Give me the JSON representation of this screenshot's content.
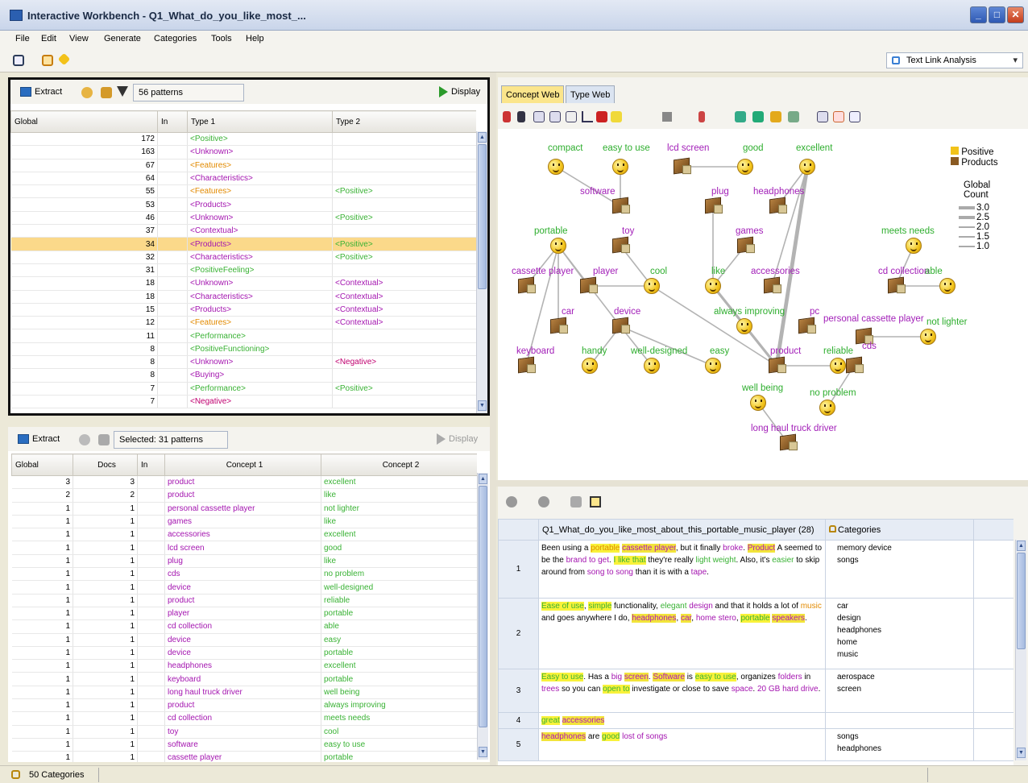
{
  "window": {
    "title": "Interactive Workbench - Q1_What_do_you_like_most_...",
    "buttons": [
      "_",
      "□",
      "✕"
    ]
  },
  "menu": [
    "File",
    "Edit",
    "View",
    "Generate",
    "Categories",
    "Tools",
    "Help"
  ],
  "mode_dropdown": {
    "value": "Text Link Analysis"
  },
  "top_left": {
    "extract_label": "Extract",
    "count_label": "56 patterns",
    "display_label": "Display",
    "columns": [
      "Global",
      "In",
      "Type 1",
      "Type 2"
    ],
    "rows": [
      {
        "global": "172",
        "t1": "<Positive>",
        "t1c": "g",
        "t2": "",
        "t2c": ""
      },
      {
        "global": "163",
        "t1": "<Unknown>",
        "t1c": "p",
        "t2": "",
        "t2c": ""
      },
      {
        "global": "67",
        "t1": "<Features>",
        "t1c": "o",
        "t2": "",
        "t2c": ""
      },
      {
        "global": "64",
        "t1": "<Characteristics>",
        "t1c": "p",
        "t2": "",
        "t2c": ""
      },
      {
        "global": "55",
        "t1": "<Features>",
        "t1c": "o",
        "t2": "<Positive>",
        "t2c": "g"
      },
      {
        "global": "53",
        "t1": "<Products>",
        "t1c": "p",
        "t2": "",
        "t2c": ""
      },
      {
        "global": "46",
        "t1": "<Unknown>",
        "t1c": "p",
        "t2": "<Positive>",
        "t2c": "g"
      },
      {
        "global": "37",
        "t1": "<Contextual>",
        "t1c": "p",
        "t2": "",
        "t2c": ""
      },
      {
        "global": "34",
        "t1": "<Products>",
        "t1c": "p",
        "t2": "<Positive>",
        "t2c": "g",
        "sel": true
      },
      {
        "global": "32",
        "t1": "<Characteristics>",
        "t1c": "p",
        "t2": "<Positive>",
        "t2c": "g"
      },
      {
        "global": "31",
        "t1": "<PositiveFeeling>",
        "t1c": "g",
        "t2": "",
        "t2c": ""
      },
      {
        "global": "18",
        "t1": "<Unknown>",
        "t1c": "p",
        "t2": "<Contextual>",
        "t2c": "p"
      },
      {
        "global": "18",
        "t1": "<Characteristics>",
        "t1c": "p",
        "t2": "<Contextual>",
        "t2c": "p"
      },
      {
        "global": "15",
        "t1": "<Products>",
        "t1c": "p",
        "t2": "<Contextual>",
        "t2c": "p"
      },
      {
        "global": "12",
        "t1": "<Features>",
        "t1c": "o",
        "t2": "<Contextual>",
        "t2c": "p"
      },
      {
        "global": "11",
        "t1": "<Performance>",
        "t1c": "g",
        "t2": "",
        "t2c": ""
      },
      {
        "global": "8",
        "t1": "<PositiveFunctioning>",
        "t1c": "g",
        "t2": "",
        "t2c": ""
      },
      {
        "global": "8",
        "t1": "<Unknown>",
        "t1c": "p",
        "t2": "<Negative>",
        "t2c": "r"
      },
      {
        "global": "8",
        "t1": "<Buying>",
        "t1c": "p",
        "t2": "",
        "t2c": ""
      },
      {
        "global": "7",
        "t1": "<Performance>",
        "t1c": "g",
        "t2": "<Positive>",
        "t2c": "g"
      },
      {
        "global": "7",
        "t1": "<Negative>",
        "t1c": "r",
        "t2": "",
        "t2c": ""
      }
    ]
  },
  "bottom_left": {
    "extract_label": "Extract",
    "count_label": "Selected: 31 patterns",
    "display_label": "Display",
    "columns": [
      "Global",
      "Docs",
      "In",
      "Concept 1",
      "Concept 2"
    ],
    "rows": [
      {
        "global": "3",
        "docs": "3",
        "c1": "product",
        "c2": "excellent"
      },
      {
        "global": "2",
        "docs": "2",
        "c1": "product",
        "c2": "like"
      },
      {
        "global": "1",
        "docs": "1",
        "c1": "personal cassette player",
        "c2": "not lighter"
      },
      {
        "global": "1",
        "docs": "1",
        "c1": "games",
        "c2": "like"
      },
      {
        "global": "1",
        "docs": "1",
        "c1": "accessories",
        "c2": "excellent"
      },
      {
        "global": "1",
        "docs": "1",
        "c1": "lcd screen",
        "c2": "good"
      },
      {
        "global": "1",
        "docs": "1",
        "c1": "plug",
        "c2": "like"
      },
      {
        "global": "1",
        "docs": "1",
        "c1": "cds",
        "c2": "no problem"
      },
      {
        "global": "1",
        "docs": "1",
        "c1": "device",
        "c2": "well-designed"
      },
      {
        "global": "1",
        "docs": "1",
        "c1": "product",
        "c2": "reliable"
      },
      {
        "global": "1",
        "docs": "1",
        "c1": "player",
        "c2": "portable"
      },
      {
        "global": "1",
        "docs": "1",
        "c1": "cd collection",
        "c2": "able"
      },
      {
        "global": "1",
        "docs": "1",
        "c1": "device",
        "c2": "easy"
      },
      {
        "global": "1",
        "docs": "1",
        "c1": "device",
        "c2": "portable"
      },
      {
        "global": "1",
        "docs": "1",
        "c1": "headphones",
        "c2": "excellent"
      },
      {
        "global": "1",
        "docs": "1",
        "c1": "keyboard",
        "c2": "portable"
      },
      {
        "global": "1",
        "docs": "1",
        "c1": "long haul truck driver",
        "c2": "well being"
      },
      {
        "global": "1",
        "docs": "1",
        "c1": "product",
        "c2": "always improving"
      },
      {
        "global": "1",
        "docs": "1",
        "c1": "cd collection",
        "c2": "meets needs"
      },
      {
        "global": "1",
        "docs": "1",
        "c1": "toy",
        "c2": "cool"
      },
      {
        "global": "1",
        "docs": "1",
        "c1": "software",
        "c2": "easy to use"
      },
      {
        "global": "1",
        "docs": "1",
        "c1": "cassette player",
        "c2": "portable"
      }
    ]
  },
  "web_tabs": [
    "Concept Web",
    "Type Web"
  ],
  "legend": {
    "positive": "Positive",
    "products": "Products",
    "title1": "Global",
    "title2": "Count",
    "scale": [
      "3.0",
      "2.5",
      "2.0",
      "1.5",
      "1.0"
    ]
  },
  "web_nodes": [
    {
      "id": "compact",
      "label": "compact",
      "kind": "s"
    },
    {
      "id": "easytouse",
      "label": "easy to use",
      "kind": "s"
    },
    {
      "id": "lcd",
      "label": "lcd screen",
      "kind": "b"
    },
    {
      "id": "good",
      "label": "good",
      "kind": "s"
    },
    {
      "id": "excellent",
      "label": "excellent",
      "kind": "s"
    },
    {
      "id": "software",
      "label": "software",
      "kind": "b"
    },
    {
      "id": "plug",
      "label": "plug",
      "kind": "b"
    },
    {
      "id": "headphones",
      "label": "headphones",
      "kind": "b"
    },
    {
      "id": "portable",
      "label": "portable",
      "kind": "s"
    },
    {
      "id": "toy",
      "label": "toy",
      "kind": "b"
    },
    {
      "id": "games",
      "label": "games",
      "kind": "b"
    },
    {
      "id": "meetsneeds",
      "label": "meets needs",
      "kind": "s"
    },
    {
      "id": "cassette",
      "label": "cassette player",
      "kind": "b"
    },
    {
      "id": "player",
      "label": "player",
      "kind": "b"
    },
    {
      "id": "cool",
      "label": "cool",
      "kind": "s"
    },
    {
      "id": "like",
      "label": "like",
      "kind": "s"
    },
    {
      "id": "accessories",
      "label": "accessories",
      "kind": "b"
    },
    {
      "id": "cdcollection",
      "label": "cd collection",
      "kind": "b"
    },
    {
      "id": "able",
      "label": "able",
      "kind": "s"
    },
    {
      "id": "car",
      "label": "car",
      "kind": "b"
    },
    {
      "id": "device",
      "label": "device",
      "kind": "b"
    },
    {
      "id": "alwaysimproving",
      "label": "always improving",
      "kind": "s"
    },
    {
      "id": "pc",
      "label": "pc",
      "kind": "b"
    },
    {
      "id": "pcp",
      "label": "personal cassette player",
      "kind": "b"
    },
    {
      "id": "notlighter",
      "label": "not lighter",
      "kind": "s"
    },
    {
      "id": "keyboard",
      "label": "keyboard",
      "kind": "b"
    },
    {
      "id": "handy",
      "label": "handy",
      "kind": "s"
    },
    {
      "id": "welldesigned",
      "label": "well-designed",
      "kind": "s"
    },
    {
      "id": "easy",
      "label": "easy",
      "kind": "s"
    },
    {
      "id": "product",
      "label": "product",
      "kind": "b"
    },
    {
      "id": "reliable",
      "label": "reliable",
      "kind": "s"
    },
    {
      "id": "cds",
      "label": "cds",
      "kind": "b"
    },
    {
      "id": "wellbeing",
      "label": "well being",
      "kind": "s"
    },
    {
      "id": "noproblem",
      "label": "no problem",
      "kind": "s"
    },
    {
      "id": "lhtd",
      "label": "long haul truck driver",
      "kind": "b"
    }
  ],
  "web_edges": [
    [
      "product",
      "excellent",
      3
    ],
    [
      "product",
      "like",
      2
    ],
    [
      "headphones",
      "excellent",
      1
    ],
    [
      "accessories",
      "excellent",
      1
    ],
    [
      "lcd",
      "good",
      1
    ],
    [
      "plug",
      "like",
      1
    ],
    [
      "games",
      "like",
      1
    ],
    [
      "software",
      "easytouse",
      1
    ],
    [
      "toy",
      "cool",
      1
    ],
    [
      "player",
      "portable",
      1
    ],
    [
      "cassette",
      "portable",
      1
    ],
    [
      "keyboard",
      "portable",
      1
    ],
    [
      "device",
      "portable",
      1
    ],
    [
      "device",
      "welldesigned",
      1
    ],
    [
      "device",
      "easy",
      1
    ],
    [
      "product",
      "reliable",
      1
    ],
    [
      "product",
      "alwaysimproving",
      1
    ],
    [
      "cdcollection",
      "able",
      1
    ],
    [
      "cdcollection",
      "meetsneeds",
      1
    ],
    [
      "pcp",
      "notlighter",
      1
    ],
    [
      "cds",
      "noproblem",
      1
    ],
    [
      "lhtd",
      "wellbeing",
      1
    ],
    [
      "car",
      "portable",
      1
    ],
    [
      "handy",
      "device",
      1
    ],
    [
      "compact",
      "software",
      1
    ],
    [
      "player",
      "cool",
      1
    ],
    [
      "product",
      "cool",
      1
    ]
  ],
  "docs": {
    "col_question": "Q1_What_do_you_like_most_about_this_portable_music_player (28)",
    "col_categories": "Categories",
    "rows": [
      {
        "n": "1",
        "categories": [
          "memory device",
          "songs"
        ]
      },
      {
        "n": "2",
        "categories": [
          "car",
          "design",
          "headphones",
          "home",
          "music"
        ]
      },
      {
        "n": "3",
        "categories": [
          "aerospace",
          "screen"
        ]
      },
      {
        "n": "4",
        "categories": []
      },
      {
        "n": "5",
        "categories": [
          "songs",
          "headphones"
        ]
      }
    ]
  },
  "status": {
    "text": "50 Categories"
  }
}
